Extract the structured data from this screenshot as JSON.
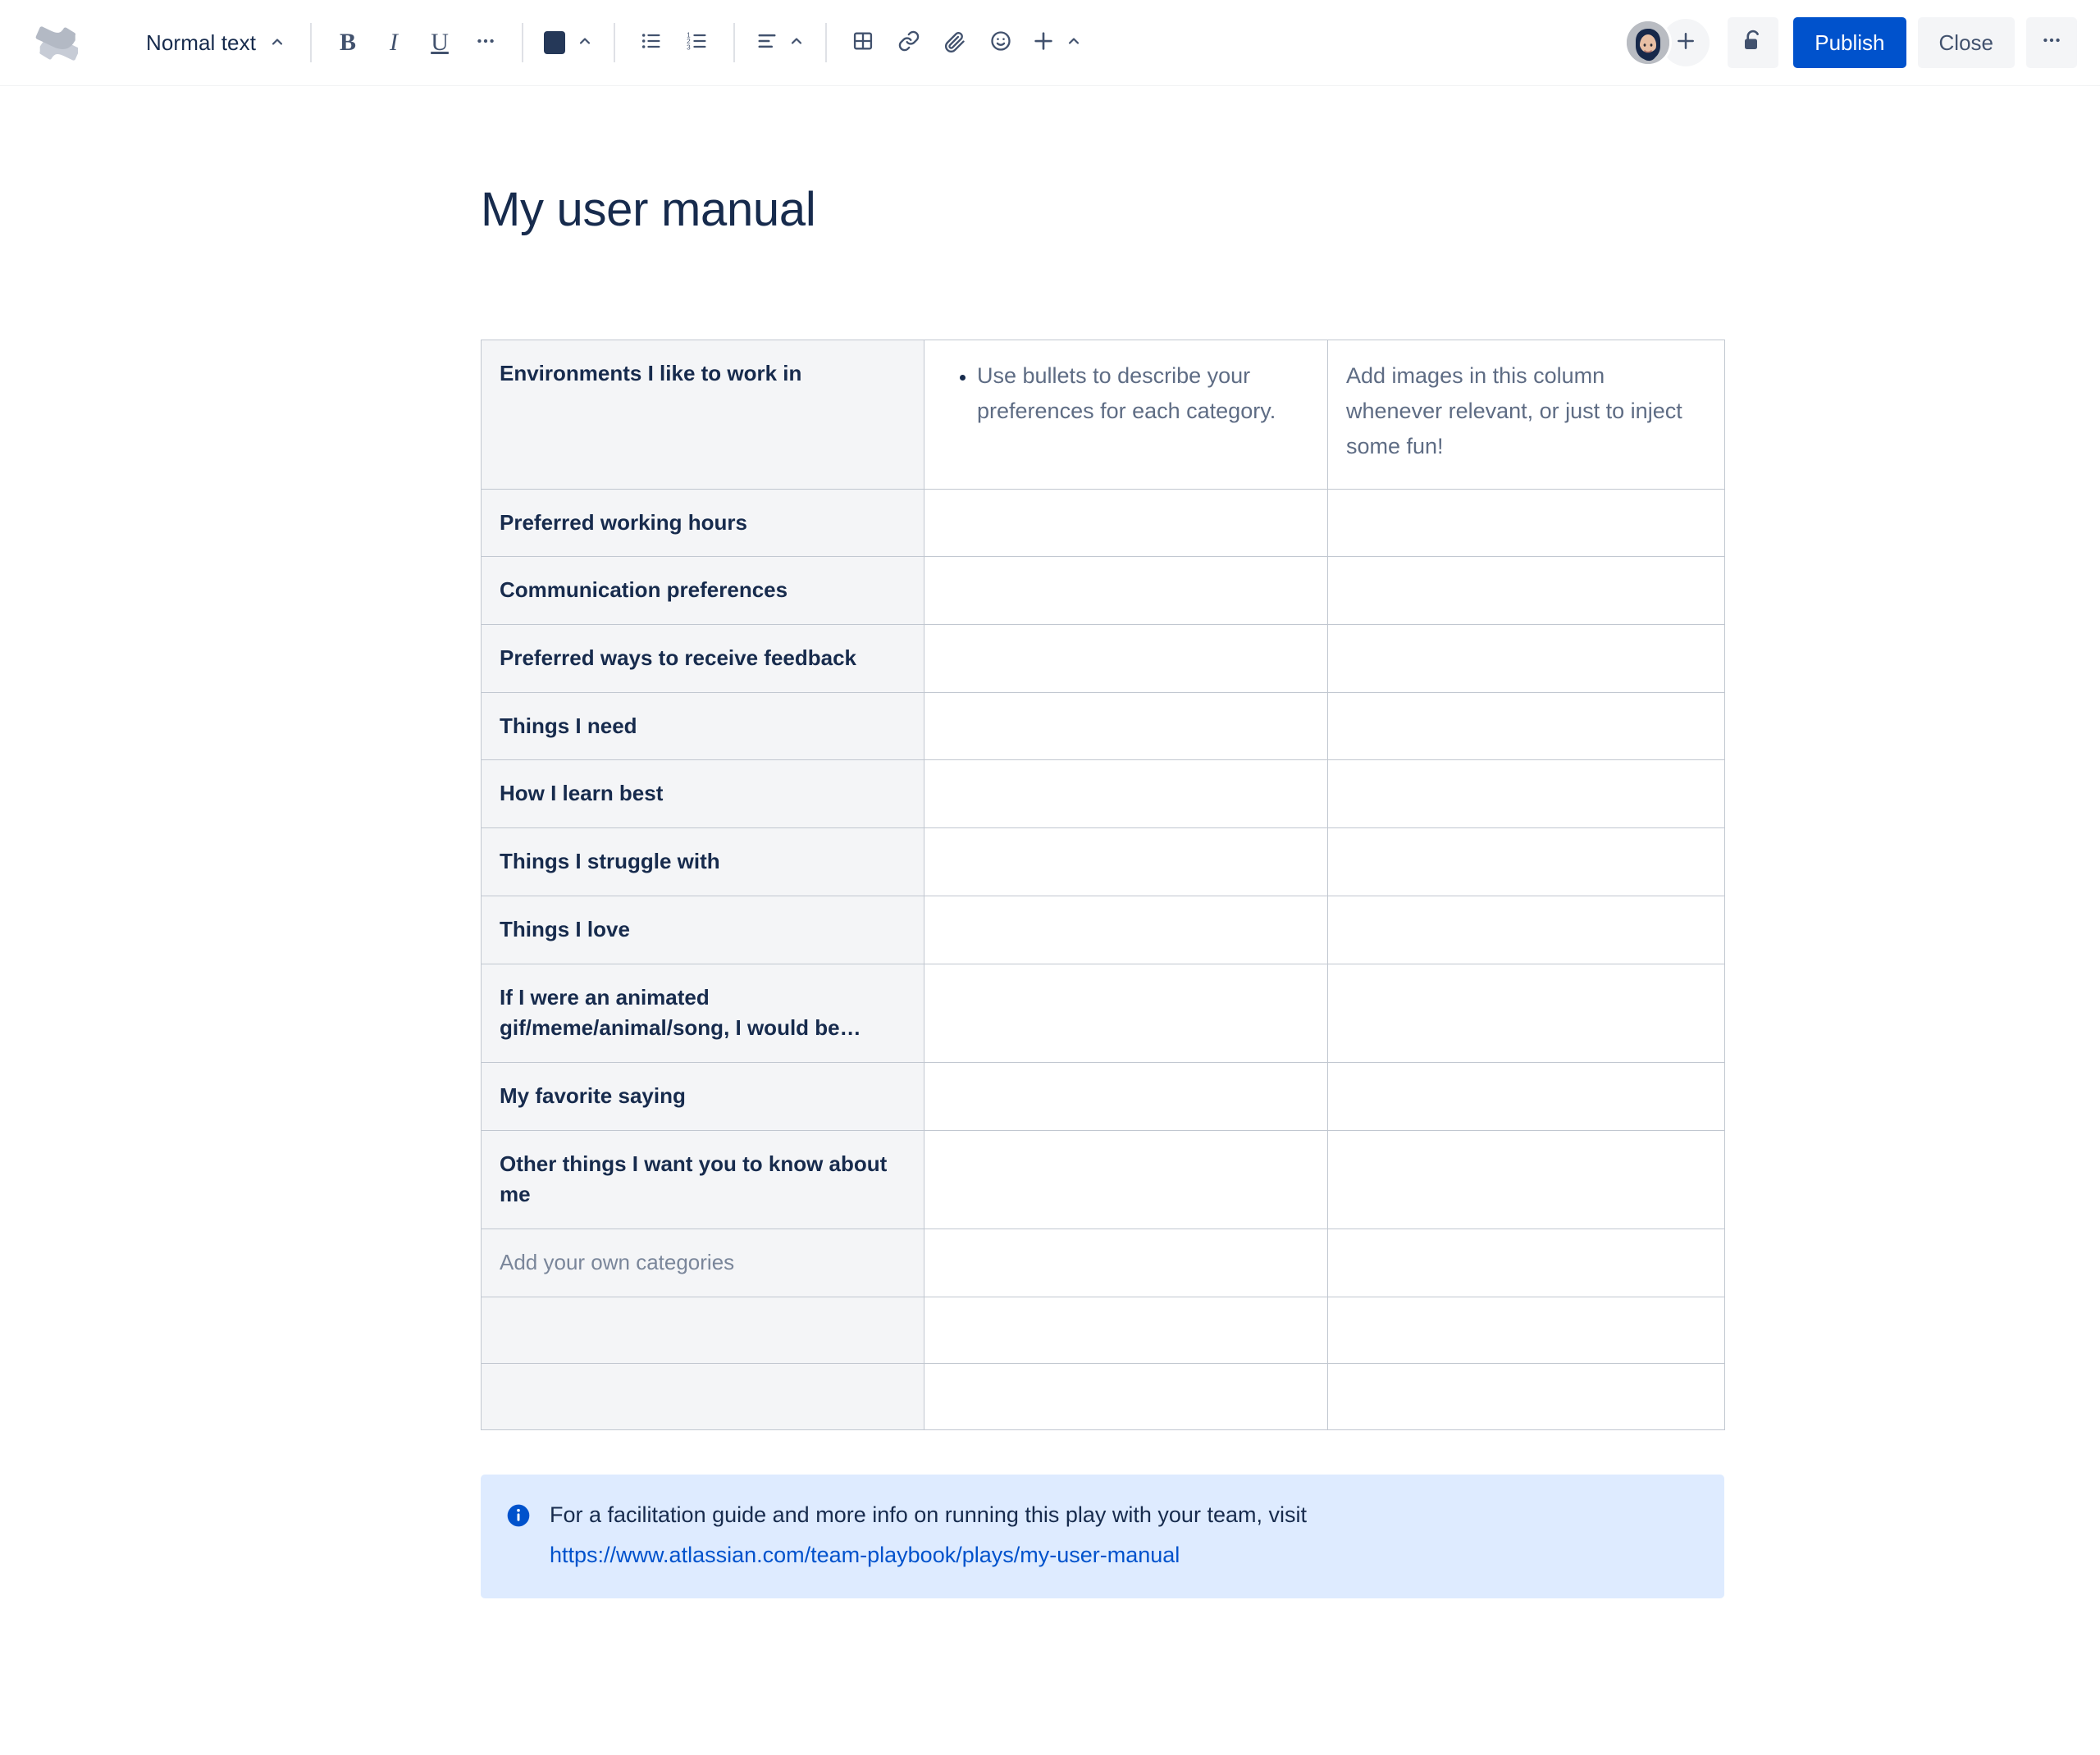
{
  "app": {
    "logo_icon": "confluence-logo-icon"
  },
  "toolbar": {
    "text_style": {
      "label": "Normal text",
      "chevron_icon": "chevron-up-icon"
    },
    "bold_label": "B",
    "italic_label": "I",
    "underline_label": "U",
    "more_formatting_icon": "ellipsis-icon",
    "text_color_icon": "text-color-swatch-icon",
    "text_color_value": "#253858",
    "text_color_chevron_icon": "chevron-up-icon",
    "bullet_list_icon": "bullet-list-icon",
    "numbered_list_icon": "numbered-list-icon",
    "alignment_icon": "text-align-left-icon",
    "alignment_chevron_icon": "chevron-up-icon",
    "table_icon": "table-icon",
    "link_icon": "link-icon",
    "attachment_icon": "paperclip-icon",
    "emoji_icon": "emoji-smiley-icon",
    "insert_icon": "plus-icon",
    "insert_chevron_icon": "chevron-up-icon",
    "avatar_icon": "user-avatar",
    "add_person_icon": "plus-icon",
    "restrictions_icon": "unlocked-padlock-icon",
    "publish_label": "Publish",
    "close_label": "Close",
    "more_actions_icon": "ellipsis-icon",
    "accent_color": "#0052cc"
  },
  "document": {
    "title": "My user manual"
  },
  "table": {
    "rows": [
      {
        "label": "Environments I like to work in",
        "bullets": [
          "Use bullets to describe your preferences for each category."
        ],
        "media": "Add images in this column whenever relevant, or just to inject some fun!",
        "type": "intro"
      },
      {
        "label": "Preferred working hours",
        "bullets": [],
        "media": "",
        "type": "std"
      },
      {
        "label": "Communication preferences",
        "bullets": [],
        "media": "",
        "type": "std"
      },
      {
        "label": "Preferred ways to receive feedback",
        "bullets": [],
        "media": "",
        "type": "std"
      },
      {
        "label": "Things I need",
        "bullets": [],
        "media": "",
        "type": "std"
      },
      {
        "label": "How I learn best",
        "bullets": [],
        "media": "",
        "type": "std"
      },
      {
        "label": "Things I struggle with",
        "bullets": [],
        "media": "",
        "type": "std"
      },
      {
        "label": "Things I love",
        "bullets": [],
        "media": "",
        "type": "std"
      },
      {
        "label": "If I were an animated gif/meme/animal/song, I would be…",
        "bullets": [],
        "media": "",
        "type": "tall"
      },
      {
        "label": "My favorite saying",
        "bullets": [],
        "media": "",
        "type": "std"
      },
      {
        "label": "Other things I want you to know about me",
        "bullets": [],
        "media": "",
        "type": "tall"
      },
      {
        "label": "Add your own categories",
        "bullets": [],
        "media": "",
        "type": "placeholder"
      },
      {
        "label": "",
        "bullets": [],
        "media": "",
        "type": "blank"
      },
      {
        "label": "",
        "bullets": [],
        "media": "",
        "type": "blank"
      }
    ]
  },
  "info_panel": {
    "icon": "info-circle-icon",
    "text": "For a facilitation guide and more info on running this play with your team, visit",
    "link_text": "https://www.atlassian.com/team-playbook/plays/my-user-manual",
    "background_color": "#deebff",
    "link_color": "#0052cc"
  }
}
